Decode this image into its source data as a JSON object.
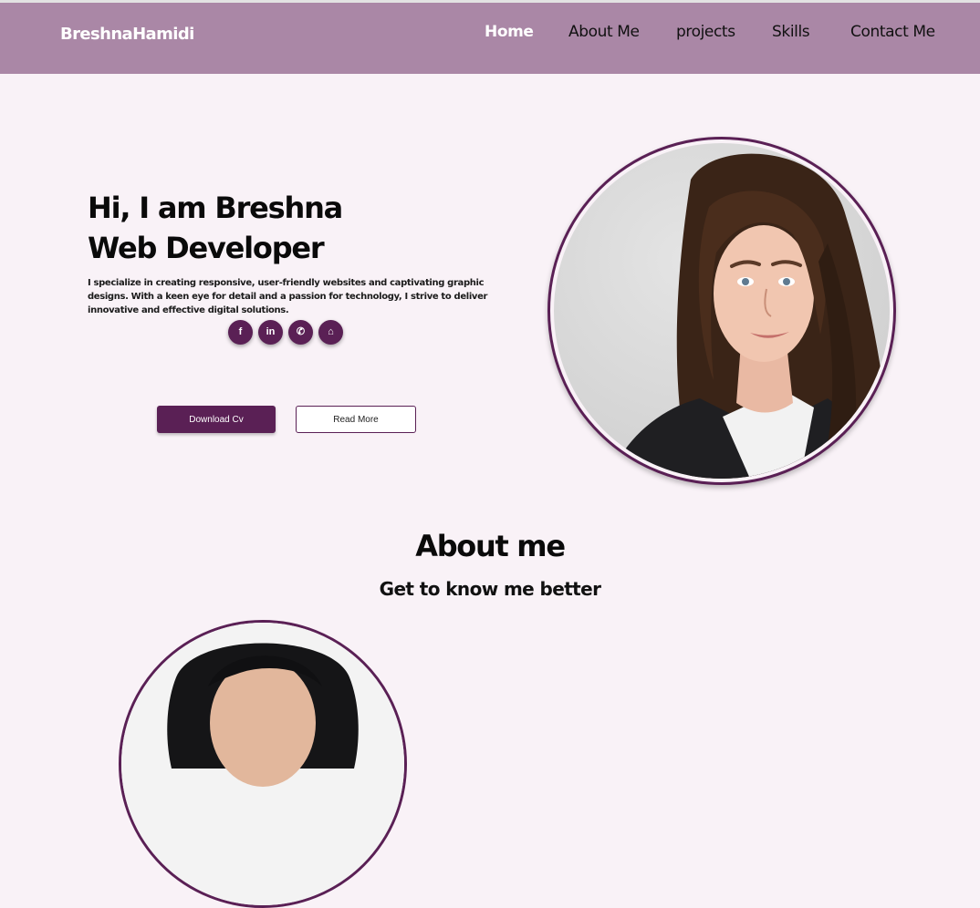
{
  "nav": {
    "brand": "BreshnaHamidi",
    "links": [
      {
        "label": "Home",
        "active": true
      },
      {
        "label": "About Me",
        "active": false
      },
      {
        "label": "projects",
        "active": false
      },
      {
        "label": "Skills",
        "active": false
      },
      {
        "label": "Contact Me",
        "active": false
      }
    ]
  },
  "hero": {
    "line1": "Hi, I am Breshna",
    "line2": "Web Developer",
    "description": "I specialize in creating responsive, user-friendly websites and captivating graphic designs. With a keen eye for detail and a passion for technology, I strive to deliver innovative and effective digital solutions.",
    "socials": [
      {
        "icon": "facebook-icon",
        "glyph": "f"
      },
      {
        "icon": "linkedin-icon",
        "glyph": "in"
      },
      {
        "icon": "whatsapp-icon",
        "glyph": "✆"
      },
      {
        "icon": "github-icon",
        "glyph": "⌂"
      }
    ],
    "buttons": {
      "download": "Download Cv",
      "read_more": "Read More"
    }
  },
  "about": {
    "title": "About me",
    "subtitle": "Get to know me better"
  },
  "colors": {
    "navbar": "#aa87a6",
    "accent": "#5a2055",
    "page_background": "#f9f2f7"
  }
}
